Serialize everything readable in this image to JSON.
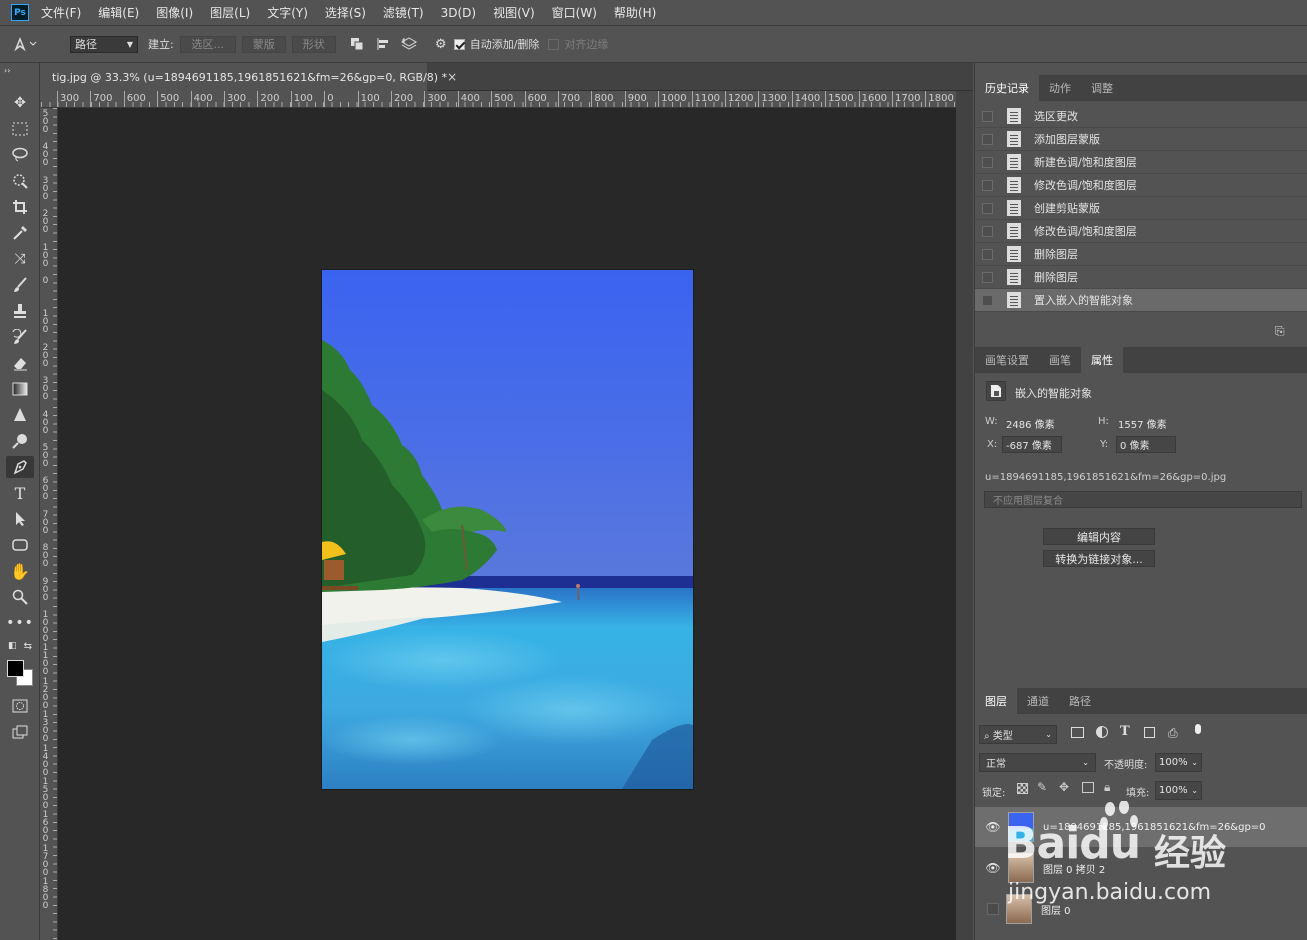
{
  "app": {
    "logo_text": "Ps"
  },
  "menubar": [
    "文件(F)",
    "编辑(E)",
    "图像(I)",
    "图层(L)",
    "文字(Y)",
    "选择(S)",
    "滤镜(T)",
    "3D(D)",
    "视图(V)",
    "窗口(W)",
    "帮助(H)"
  ],
  "options": {
    "mode_select": "路径",
    "make_label": "建立:",
    "selection_btn": "选区...",
    "mask_btn": "蒙版",
    "shape_btn": "形状",
    "auto_add_delete": "自动添加/删除",
    "align_edges": "对齐边缘"
  },
  "document": {
    "tab_title": "tig.jpg @ 33.3% (u=1894691185,1961851621&fm=26&gp=0, RGB/8) *",
    "close": "×",
    "ruler_labels": [
      "300",
      "700",
      "600",
      "500",
      "400",
      "300",
      "200",
      "100",
      "0",
      "100",
      "200",
      "300",
      "400",
      "500",
      "600",
      "700",
      "800",
      "900",
      "1000",
      "1100",
      "1200",
      "1300",
      "1400",
      "1500",
      "1600",
      "1700",
      "1800"
    ],
    "vruler_labels": [
      "5 0 0",
      "4 0 0",
      "3 0 0",
      "2 0 0",
      "1 0 0",
      "0",
      "1 0 0",
      "2 0 0",
      "3 0 0",
      "4 0 0",
      "5 0 0",
      "6 0 0",
      "7 0 0",
      "8 0 0",
      "9 0 0",
      "1 0 0 0",
      "1 1 0 0",
      "1 2 0 0",
      "1 3 0 0",
      "1 4 0 0",
      "1 5 0 0",
      "1 6 0 0",
      "1 7 0 0",
      "1 8 0 0"
    ]
  },
  "history_panel": {
    "tabs": [
      "历史记录",
      "动作",
      "调整"
    ],
    "items": [
      "选区更改",
      "添加图层蒙版",
      "新建色调/饱和度图层",
      "修改色调/饱和度图层",
      "创建剪贴蒙版",
      "修改色调/饱和度图层",
      "删除图层",
      "删除图层",
      "置入嵌入的智能对象"
    ]
  },
  "properties_panel": {
    "tabs": [
      "画笔设置",
      "画笔",
      "属性"
    ],
    "type_label": "嵌入的智能对象",
    "w_label": "W:",
    "w_value": "2486 像素",
    "h_label": "H:",
    "h_value": "1557 像素",
    "x_label": "X:",
    "x_value": "-687 像素",
    "y_label": "Y:",
    "y_value": "0 像素",
    "filename": "u=1894691185,1961851621&fm=26&gp=0.jpg",
    "comp_placeholder": "不应用图层复合",
    "edit_btn": "编辑内容",
    "convert_btn": "转换为链接对象..."
  },
  "layers_panel": {
    "tabs": [
      "图层",
      "通道",
      "路径"
    ],
    "filter_select": "类型",
    "blend_mode": "正常",
    "opacity_label": "不透明度:",
    "opacity_value": "100%",
    "lock_label": "锁定:",
    "fill_label": "填充:",
    "fill_value": "100%",
    "layers": [
      {
        "name": "u=1894691185,1961851621&fm=26&gp=0",
        "visible": true,
        "selected": true
      },
      {
        "name": "图层 0 拷贝 2",
        "visible": true,
        "selected": false
      },
      {
        "name": "图层 0",
        "visible": false,
        "selected": false
      }
    ]
  },
  "watermark": {
    "brand": "Baidu",
    "cn": "经验",
    "url": "jingyan.baidu.com"
  },
  "colors": {
    "accent": "#31a8ff",
    "canvas_bg": "#282828",
    "panel_bg": "#535353"
  }
}
